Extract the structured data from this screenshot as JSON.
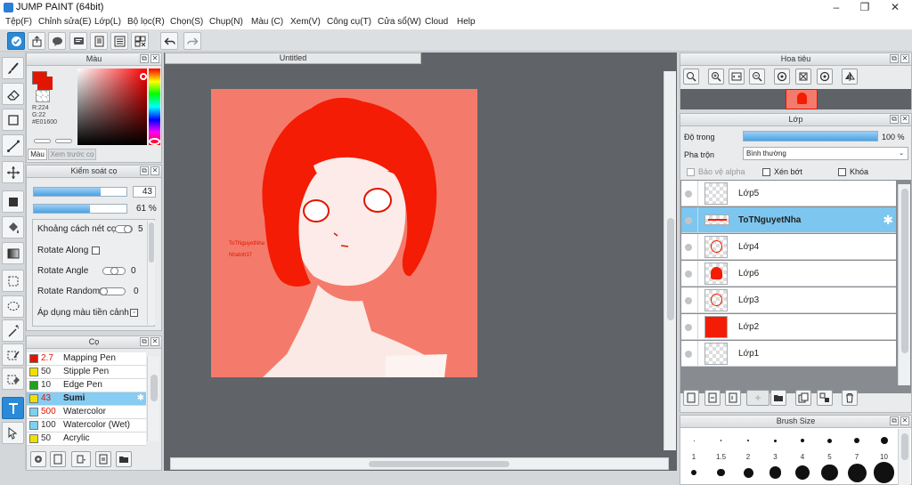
{
  "window": {
    "title": "JUMP PAINT (64bit)",
    "minimize": "–",
    "maximize": "❐",
    "close": "✕"
  },
  "menu": [
    "Tệp(F)",
    "Chỉnh sửa(E)",
    "Lớp(L)",
    "Bộ lọc(R)",
    "Chọn(S)",
    "Chụp(N)",
    "Màu (C)",
    "Xem(V)",
    "Công cụ(T)",
    "Cửa sổ(W)",
    "Cloud",
    "Help"
  ],
  "document": {
    "tab": "Untitled",
    "signature_line1": "ToTNguyetNha",
    "signature_line2": "Nhatnh37"
  },
  "color_panel": {
    "title": "Màu",
    "r": "R:224",
    "g": "G:22",
    "hex": "#E01600",
    "tab_color": "Màu",
    "tab_preview": "Xem trước cọ",
    "current_color": "#e01600"
  },
  "brush_control": {
    "title": "Kiểm soát cọ",
    "size_value": "43",
    "size_fill": 0.72,
    "opacity_value": "61 %",
    "opacity_fill": 0.61,
    "spacing_label": "Khoảng cách nét cọ",
    "spacing_value": "5",
    "rotate_along_label": "Rotate Along",
    "rotate_angle_label": "Rotate Angle",
    "rotate_angle_value": "0",
    "rotate_random_label": "Rotate Random",
    "rotate_random_value": "0",
    "apply_color_label": "Áp dụng màu tiền cảnh"
  },
  "brush_panel": {
    "title": "Cọ",
    "brushes": [
      {
        "size": "2.7",
        "name": "Mapping Pen",
        "color": "#e01600",
        "selected": false
      },
      {
        "size": "50",
        "name": "Stipple Pen",
        "color": "#f0e000",
        "selected": false
      },
      {
        "size": "10",
        "name": "Edge Pen",
        "color": "#20a020",
        "selected": false
      },
      {
        "size": "43",
        "name": "Sumi",
        "color": "#f0e000",
        "selected": true
      },
      {
        "size": "500",
        "name": "Watercolor",
        "color": "#80d0f0",
        "selected": false
      },
      {
        "size": "100",
        "name": "Watercolor (Wet)",
        "color": "#80d0f0",
        "selected": false
      },
      {
        "size": "50",
        "name": "Acrylic",
        "color": "#f0e000",
        "selected": false
      }
    ]
  },
  "navigator": {
    "title": "Hoa tiêu"
  },
  "layers": {
    "title": "Lớp",
    "opacity_label": "Độ trong",
    "opacity_value": "100 %",
    "opacity_fill": 1.0,
    "blend_label": "Pha trộn",
    "blend_value": "Bình thường",
    "protect_alpha": "Bảo vệ alpha",
    "clipping": "Xén bớt",
    "lock": "Khóa",
    "items": [
      {
        "name": "Lớp5",
        "thumb": "empty",
        "selected": false
      },
      {
        "name": "ToTNguyetNha",
        "thumb": "text",
        "selected": true
      },
      {
        "name": "Lớp4",
        "thumb": "sketch",
        "selected": false
      },
      {
        "name": "Lớp6",
        "thumb": "hair",
        "selected": false
      },
      {
        "name": "Lớp3",
        "thumb": "sketch",
        "selected": false
      },
      {
        "name": "Lớp2",
        "thumb": "red",
        "selected": false
      },
      {
        "name": "Lớp1",
        "thumb": "empty",
        "selected": false
      }
    ]
  },
  "brush_size_panel": {
    "title": "Brush Size",
    "sizes": [
      "1",
      "1.5",
      "2",
      "3",
      "4",
      "5",
      "7",
      "10"
    ]
  }
}
